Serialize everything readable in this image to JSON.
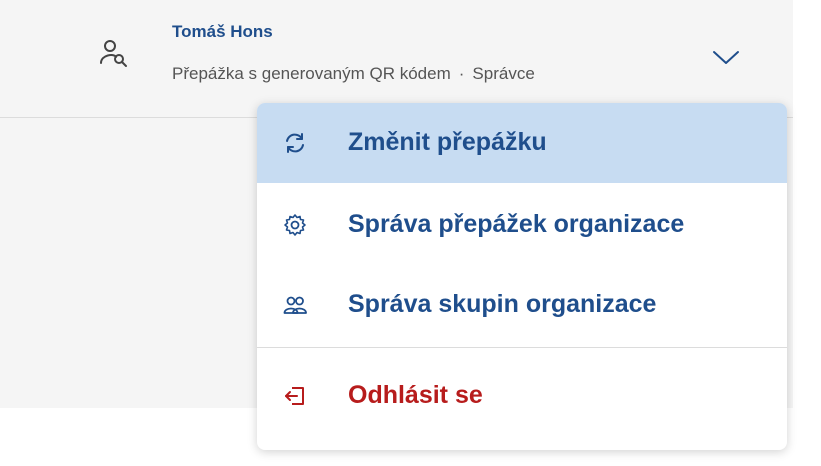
{
  "user": {
    "name": "Tomáš Hons",
    "counter": "Přepážka s generovaným QR kódem",
    "separator": "·",
    "role": "Správce",
    "icon": "user-search-icon"
  },
  "menu": {
    "items": [
      {
        "label": "Změnit přepážku",
        "icon": "refresh-icon",
        "active": true
      },
      {
        "label": "Správa přepážek organizace",
        "icon": "gear-icon"
      },
      {
        "label": "Správa skupin organizace",
        "icon": "users-icon"
      },
      {
        "label": "Odhlásit se",
        "icon": "logout-icon"
      }
    ]
  },
  "colors": {
    "primary": "#1f4e8c",
    "danger": "#b71c1c",
    "active_bg": "#c7dcf2",
    "header_bg": "#f5f5f5"
  }
}
